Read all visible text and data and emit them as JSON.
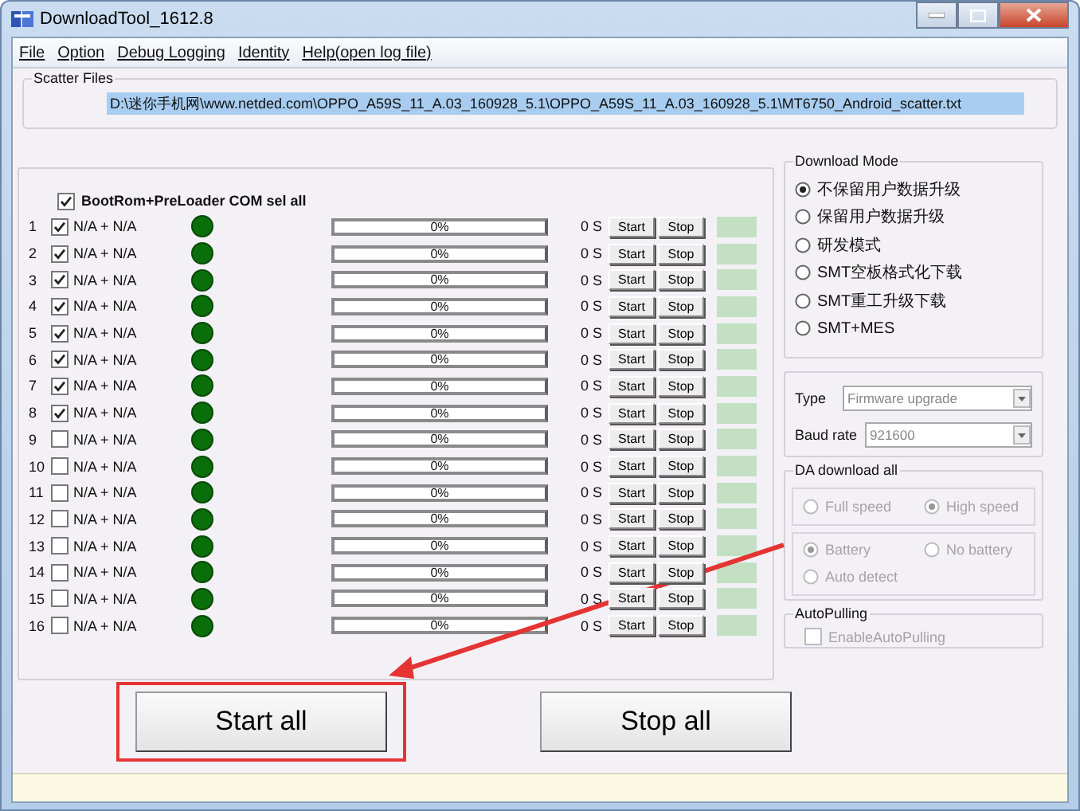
{
  "window": {
    "title": "DownloadTool_1612.8"
  },
  "menu": [
    {
      "label": "File"
    },
    {
      "label": "Option"
    },
    {
      "label": "Debug Logging"
    },
    {
      "label": "Identity"
    },
    {
      "label": "Help(open log file)"
    }
  ],
  "scatter_files": {
    "title": "Scatter Files",
    "path": "D:\\迷你手机网\\www.netded.com\\OPPO_A59S_11_A.03_160928_5.1\\OPPO_A59S_11_A.03_160928_5.1\\MT6750_Android_scatter.txt"
  },
  "ports": {
    "select_all": {
      "label": "BootRom+PreLoader COM sel all",
      "checked": true
    },
    "rows": [
      {
        "number": "1",
        "checked": true,
        "label": "N/A + N/A",
        "progress": "0%",
        "level": 0,
        "time": "0 S",
        "start": "Start",
        "stop": "Stop"
      },
      {
        "number": "2",
        "checked": true,
        "label": "N/A + N/A",
        "progress": "0%",
        "level": 0,
        "time": "0 S",
        "start": "Start",
        "stop": "Stop"
      },
      {
        "number": "3",
        "checked": true,
        "label": "N/A + N/A",
        "progress": "0%",
        "level": 0,
        "time": "0 S",
        "start": "Start",
        "stop": "Stop"
      },
      {
        "number": "4",
        "checked": true,
        "label": "N/A + N/A",
        "progress": "0%",
        "level": 0,
        "time": "0 S",
        "start": "Start",
        "stop": "Stop"
      },
      {
        "number": "5",
        "checked": true,
        "label": "N/A + N/A",
        "progress": "0%",
        "level": 0,
        "time": "0 S",
        "start": "Start",
        "stop": "Stop"
      },
      {
        "number": "6",
        "checked": true,
        "label": "N/A + N/A",
        "progress": "0%",
        "level": 0,
        "time": "0 S",
        "start": "Start",
        "stop": "Stop"
      },
      {
        "number": "7",
        "checked": true,
        "label": "N/A + N/A",
        "progress": "0%",
        "level": 0,
        "time": "0 S",
        "start": "Start",
        "stop": "Stop"
      },
      {
        "number": "8",
        "checked": true,
        "label": "N/A + N/A",
        "progress": "0%",
        "level": 0,
        "time": "0 S",
        "start": "Start",
        "stop": "Stop"
      },
      {
        "number": "9",
        "checked": false,
        "label": "N/A + N/A",
        "progress": "0%",
        "level": 0,
        "time": "0 S",
        "start": "Start",
        "stop": "Stop"
      },
      {
        "number": "10",
        "checked": false,
        "label": "N/A + N/A",
        "progress": "0%",
        "level": 0,
        "time": "0 S",
        "start": "Start",
        "stop": "Stop"
      },
      {
        "number": "11",
        "checked": false,
        "label": "N/A + N/A",
        "progress": "0%",
        "level": 0,
        "time": "0 S",
        "start": "Start",
        "stop": "Stop"
      },
      {
        "number": "12",
        "checked": false,
        "label": "N/A + N/A",
        "progress": "0%",
        "level": 0,
        "time": "0 S",
        "start": "Start",
        "stop": "Stop"
      },
      {
        "number": "13",
        "checked": false,
        "label": "N/A + N/A",
        "progress": "0%",
        "level": 0,
        "time": "0 S",
        "start": "Start",
        "stop": "Stop"
      },
      {
        "number": "14",
        "checked": false,
        "label": "N/A + N/A",
        "progress": "0%",
        "level": 0,
        "time": "0 S",
        "start": "Start",
        "stop": "Stop"
      },
      {
        "number": "15",
        "checked": false,
        "label": "N/A + N/A",
        "progress": "0%",
        "level": 0,
        "time": "0 S",
        "start": "Start",
        "stop": "Stop"
      },
      {
        "number": "16",
        "checked": false,
        "label": "N/A + N/A",
        "progress": "0%",
        "level": 0,
        "time": "0 S",
        "start": "Start",
        "stop": "Stop"
      }
    ]
  },
  "download_mode": {
    "title": "Download Mode",
    "options": [
      {
        "label": "不保留用户数据升级",
        "selected": true
      },
      {
        "label": "保留用户数据升级",
        "selected": false
      },
      {
        "label": "研发模式",
        "selected": false
      },
      {
        "label": "SMT空板格式化下载",
        "selected": false
      },
      {
        "label": "SMT重工升级下载",
        "selected": false
      },
      {
        "label": "SMT+MES",
        "selected": false
      }
    ]
  },
  "type": {
    "label": "Type",
    "value": "Firmware upgrade"
  },
  "baud_rate": {
    "label": "Baud rate",
    "value": "921600"
  },
  "da_download_all": {
    "title": "DA download all",
    "disabled": true,
    "speed_options": [
      {
        "label": "Full speed",
        "selected": false
      },
      {
        "label": "High speed",
        "selected": true
      }
    ],
    "battery_options": [
      {
        "label": "Battery",
        "selected": true
      },
      {
        "label": "No battery",
        "selected": false
      },
      {
        "label": "Auto detect",
        "selected": false
      }
    ]
  },
  "auto_pulling": {
    "title": "AutoPulling",
    "label": "EnableAutoPulling",
    "checked": false,
    "disabled": true
  },
  "buttons": [
    {
      "label": "Start all",
      "highlighted": true
    },
    {
      "label": "Stop all",
      "highlighted": false
    }
  ]
}
